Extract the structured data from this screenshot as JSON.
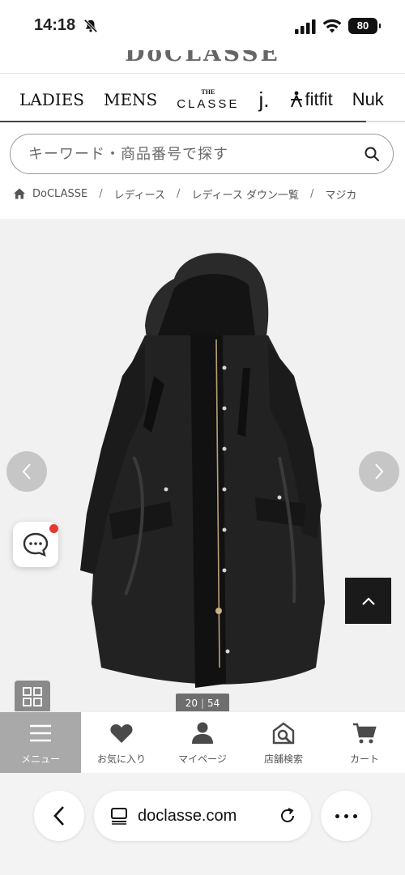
{
  "status_bar": {
    "time": "14:18",
    "battery": "80"
  },
  "logo": "DoCLASSE",
  "brand_nav": {
    "ladies": "LADIES",
    "mens": "MENS",
    "classe_the": "THE",
    "classe_name": "CLASSE",
    "j": "j.",
    "fitfit": "fitfit",
    "nuk": "Nuk"
  },
  "search": {
    "placeholder": "キーワード・商品番号で探す"
  },
  "breadcrumb": {
    "items": [
      "DoCLASSE",
      "レディース",
      "レディース ダウン一覧",
      "マジカ"
    ]
  },
  "gallery": {
    "current": "20",
    "total": "54"
  },
  "tabbar": {
    "items": [
      {
        "label": "メニュー",
        "icon": "menu-icon"
      },
      {
        "label": "お気に入り",
        "icon": "heart-icon"
      },
      {
        "label": "マイページ",
        "icon": "user-icon"
      },
      {
        "label": "店舗検索",
        "icon": "store-search-icon"
      },
      {
        "label": "カート",
        "icon": "cart-icon"
      }
    ]
  },
  "browser": {
    "url": "doclasse.com"
  },
  "colors": {
    "accent_dark": "#1a1a1a",
    "notification": "#e53935",
    "active_tab": "#a9a9a9"
  }
}
